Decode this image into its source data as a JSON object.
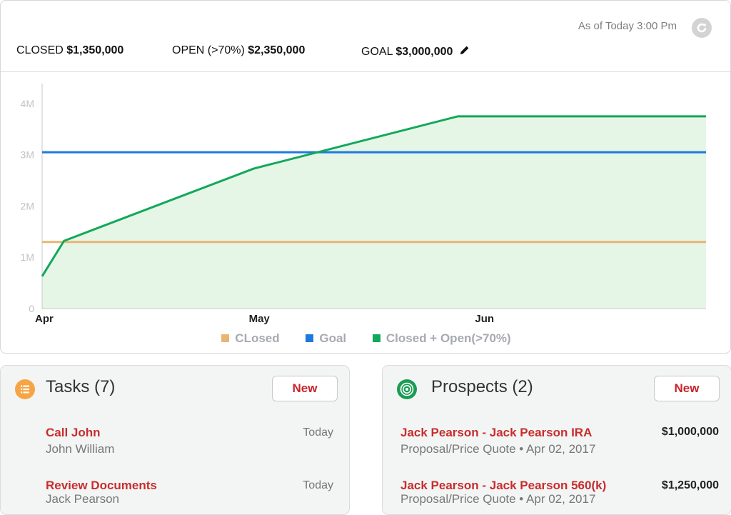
{
  "header": {
    "as_of": "As of Today 3:00 Pm",
    "closed_label": "CLOSED",
    "closed_value": "$1,350,000",
    "open_label": "OPEN (>70%)",
    "open_value": "$2,350,000",
    "goal_label": "GOAL",
    "goal_value": "$3,000,000"
  },
  "chart_data": {
    "type": "line",
    "x_tick_labels": [
      "Apr",
      "May",
      "Jun"
    ],
    "y_tick_labels": [
      "0",
      "1M",
      "2M",
      "3M",
      "4M"
    ],
    "ylim": [
      0,
      4500000
    ],
    "x_domain_days": [
      0,
      91
    ],
    "grid": false,
    "legend_position": "bottom",
    "series": [
      {
        "name": "CLosed",
        "color": "#e8b574",
        "points": [
          [
            0,
            1300000
          ],
          [
            91,
            1300000
          ]
        ]
      },
      {
        "name": "Goal",
        "color": "#1f78e0",
        "points": [
          [
            0,
            3050000
          ],
          [
            91,
            3050000
          ]
        ]
      },
      {
        "name": "Closed + Open(>70%)",
        "color": "#12a85a",
        "area": true,
        "points": [
          [
            0,
            630000
          ],
          [
            3,
            1320000
          ],
          [
            29,
            2730000
          ],
          [
            57,
            3750000
          ],
          [
            91,
            3750000
          ]
        ]
      }
    ]
  },
  "colors": {
    "closed": "#e8b574",
    "goal": "#1f78e0",
    "closed_open": "#12a85a",
    "area_fill": "#e5f6e6",
    "accent_red": "#c72d2d",
    "tasks_icon": "#f7a445",
    "prospects_icon": "#1b9b55"
  },
  "tasks": {
    "title": "Tasks (7)",
    "new_label": "New",
    "icon": "list-icon",
    "items": [
      {
        "title": "Call John",
        "sub": "John William",
        "date": "Today"
      },
      {
        "title": "Review Documents",
        "sub": "Jack Pearson",
        "date": "Today"
      }
    ]
  },
  "prospects": {
    "title": "Prospects (2)",
    "new_label": "New",
    "icon": "target-icon",
    "items": [
      {
        "title": "Jack Pearson - Jack Pearson IRA",
        "sub": "Proposal/Price Quote •  Apr 02, 2017",
        "amount": "$1,000,000"
      },
      {
        "title": "Jack Pearson - Jack Pearson 560(k)",
        "sub": "Proposal/Price Quote •  Apr 02, 2017",
        "amount": "$1,250,000"
      }
    ]
  }
}
